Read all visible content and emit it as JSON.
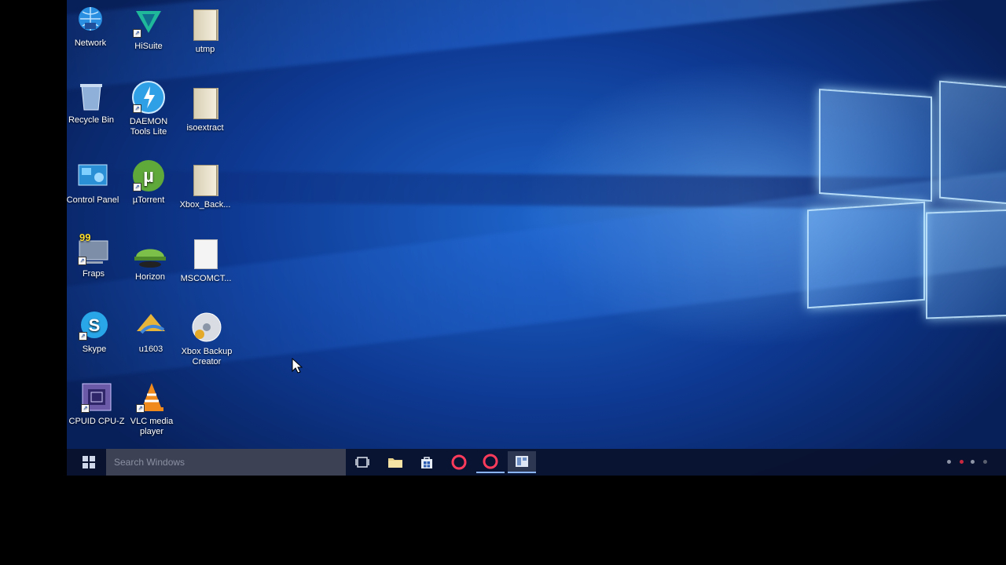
{
  "desktop": {
    "icons": [
      {
        "label": "Network"
      },
      {
        "label": "HiSuite"
      },
      {
        "label": "utmp"
      },
      {
        "label": "Recycle Bin"
      },
      {
        "label": "DAEMON Tools Lite"
      },
      {
        "label": "isoextract"
      },
      {
        "label": "Control Panel"
      },
      {
        "label": "µTorrent"
      },
      {
        "label": "Xbox_Back..."
      },
      {
        "label": "Fraps"
      },
      {
        "label": "Horizon"
      },
      {
        "label": "MSCOMCT..."
      },
      {
        "label": "Skype"
      },
      {
        "label": "u1603"
      },
      {
        "label": "Xbox Backup Creator"
      },
      {
        "label": "CPUID CPU-Z"
      },
      {
        "label": "VLC media player"
      }
    ],
    "fraps_badge": "99"
  },
  "taskbar": {
    "search_placeholder": "Search Windows",
    "buttons": [
      "task-view",
      "file-explorer",
      "store",
      "opera",
      "opera",
      "app"
    ]
  },
  "colors": {
    "accent": "#8ab4ff",
    "wallpaper": "#1d63c9",
    "taskbar": "#0a122d"
  }
}
